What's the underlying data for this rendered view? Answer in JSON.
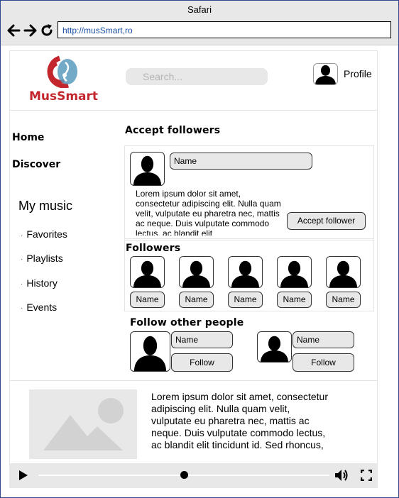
{
  "browser": {
    "title": "Safari",
    "url": "http://musSmart,ro"
  },
  "brand": {
    "name": "MusSmart",
    "color": "#c4262e",
    "accent_blue": "#5b9bbd"
  },
  "header": {
    "search_placeholder": "Search...",
    "profile_label": "Profile"
  },
  "sidebar": {
    "home": "Home",
    "discover": "Discover",
    "my_music": "My music",
    "items": [
      "Favorites",
      "Playlists",
      "History",
      "Events"
    ]
  },
  "accept_followers": {
    "title": "Accept followers",
    "name": "Name",
    "description": "Lorem ipsum dolor sit amet, consectetur adipiscing elit. Nulla quam velit, vulputate eu pharetra nec, mattis ac neque. Duis vulputate commodo lectus, ac blandit elit",
    "button": "Accept follower"
  },
  "followers": {
    "title": "Followers",
    "names": [
      "Name",
      "Name",
      "Name",
      "Name",
      "Name"
    ]
  },
  "follow_other": {
    "title": "Follow other people",
    "people": [
      {
        "name": "Name",
        "button": "Follow"
      },
      {
        "name": "Name",
        "button": "Follow"
      }
    ]
  },
  "media": {
    "description": "Lorem ipsum dolor sit amet, consectetur adipiscing elit. Nulla quam velit, vulputate eu pharetra nec, mattis ac neque. Duis vulputate commodo lectus, ac blandit elit tincidunt id. Sed rhoncus,",
    "progress": 0.5
  }
}
